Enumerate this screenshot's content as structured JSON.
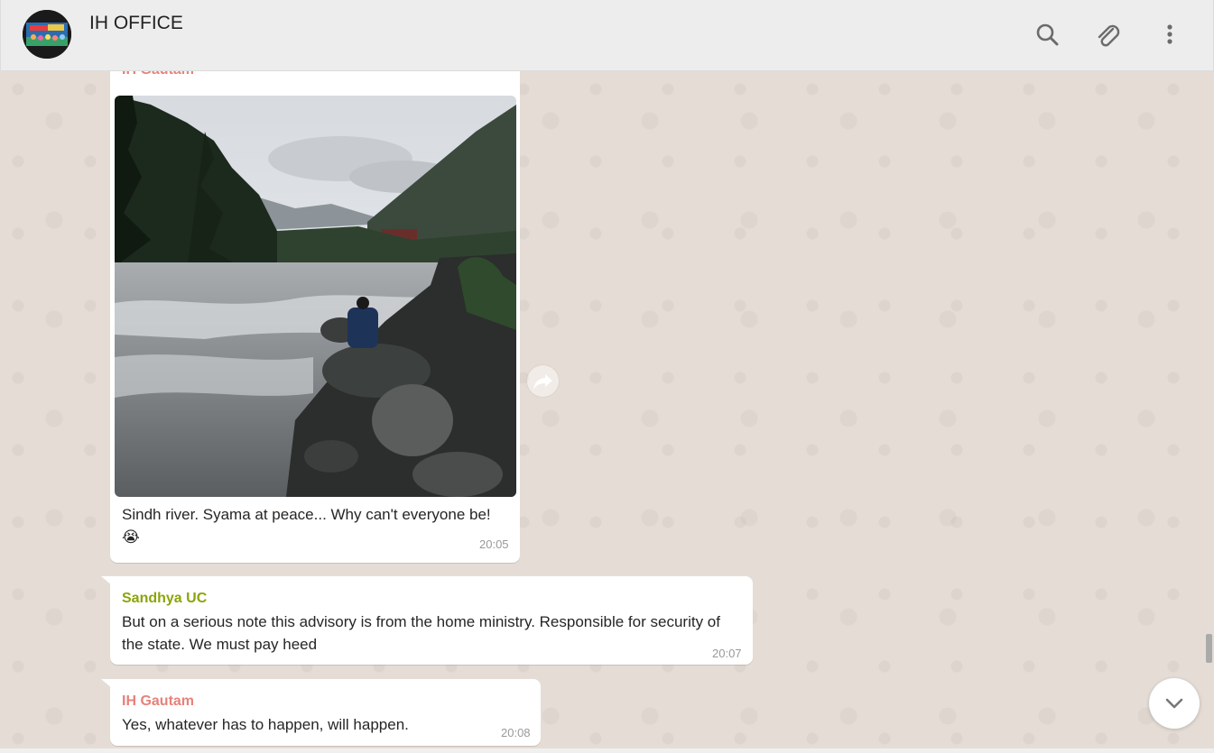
{
  "header": {
    "title": "IH OFFICE",
    "icons": [
      "search-icon",
      "paperclip-icon",
      "menu-icon"
    ]
  },
  "messages": [
    {
      "sender": "IH Gautam",
      "sender_color": "#e8817a",
      "image": "photo of a river with mountains and a person sitting on rocks",
      "text": "Sindh river. Syama at peace... Why can't everyone be! 😭",
      "time": "20:05"
    },
    {
      "sender": "Sandhya UC",
      "sender_color": "#8ca40a",
      "text": "But on a serious note this advisory is from the home ministry. Responsible for security of the state. We must pay heed",
      "time": "20:07"
    },
    {
      "sender": "IH Gautam",
      "sender_color": "#e8817a",
      "text": "Yes, whatever has to happen, will happen.",
      "time": "20:08"
    }
  ],
  "colors": {
    "header_bg": "#ededed",
    "chat_bg": "#e5ddd5",
    "bubble_bg": "#ffffff"
  }
}
